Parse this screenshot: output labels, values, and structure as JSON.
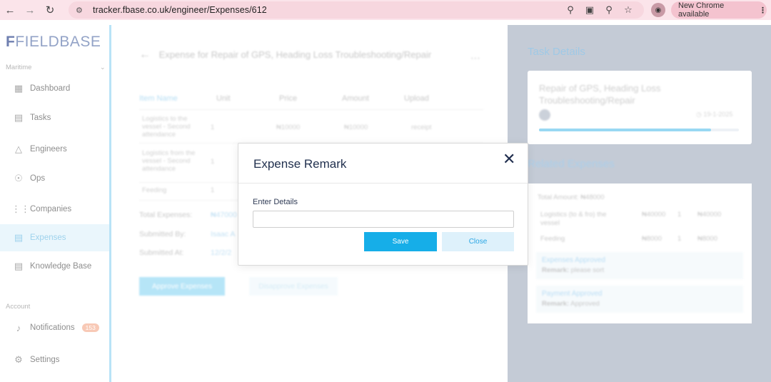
{
  "browser": {
    "url": "tracker.fbase.co.uk/engineer/Expenses/612",
    "update_label": "New Chrome available"
  },
  "sidebar": {
    "logo": "FIELDBASE",
    "section_maritime": "Maritime",
    "items": [
      {
        "label": "Dashboard",
        "icon": "grid-icon"
      },
      {
        "label": "Tasks",
        "icon": "clipboard-icon"
      },
      {
        "label": "Engineers",
        "icon": "hardhat-icon"
      },
      {
        "label": "Ops",
        "icon": "ops-icon"
      },
      {
        "label": "Companies",
        "icon": "dots-grid-icon"
      },
      {
        "label": "Expenses",
        "icon": "receipt-icon"
      },
      {
        "label": "Knowledge Base",
        "icon": "book-icon"
      }
    ],
    "section_account": "Account",
    "notifications": {
      "label": "Notifications",
      "count": "153"
    },
    "settings": {
      "label": "Settings"
    }
  },
  "main": {
    "title": "Expense for Repair of GPS, Heading Loss Troubleshooting/Repair",
    "columns": [
      "Item Name",
      "Unit",
      "Price",
      "Amount",
      "Upload"
    ],
    "rows": [
      {
        "item": "Logistics to the vessel - Second attendance",
        "unit": "1",
        "price": "₦10000",
        "amount": "₦10000",
        "upload": "receipt"
      },
      {
        "item": "Logistics from the vessel - Second attendance",
        "unit": "1",
        "price": "",
        "amount": "",
        "upload": ""
      },
      {
        "item": "Feeding",
        "unit": "1",
        "price": "",
        "amount": "",
        "upload": ""
      }
    ],
    "total_label": "Total Expenses:",
    "total_value": "₦47000",
    "submitted_by_label": "Submitted By:",
    "submitted_by_value": "Isaac A",
    "submitted_at_label": "Submitted At:",
    "submitted_at_value": "12/2/2",
    "approve_label": "Approve Expenses",
    "disapprove_label": "Disapprove Expenses"
  },
  "right": {
    "task_details_title": "Task Details",
    "task_title": "Repair of GPS, Heading Loss Troubleshooting/Repair",
    "task_date": "19-1-2025",
    "task_progress": 0.86,
    "related_title": "Related Expenses",
    "total_amount": "Total Amount: ₦48000",
    "rows": [
      {
        "item": "Logistics (to & fro) the vessel",
        "price": "₦40000",
        "unit": "1",
        "amount": "₦40000"
      },
      {
        "item": "Feeding",
        "price": "₦8000",
        "unit": "1",
        "amount": "₦8000"
      }
    ],
    "statuses": [
      {
        "title": "Expenses Approved",
        "remark_label": "Remark:",
        "remark": "please sort"
      },
      {
        "title": "Payment Approved",
        "remark_label": "Remark:",
        "remark": "Approved"
      }
    ]
  },
  "modal": {
    "title": "Expense Remark",
    "field_label": "Enter Details",
    "field_value": "",
    "save_label": "Save",
    "close_label": "Close"
  }
}
